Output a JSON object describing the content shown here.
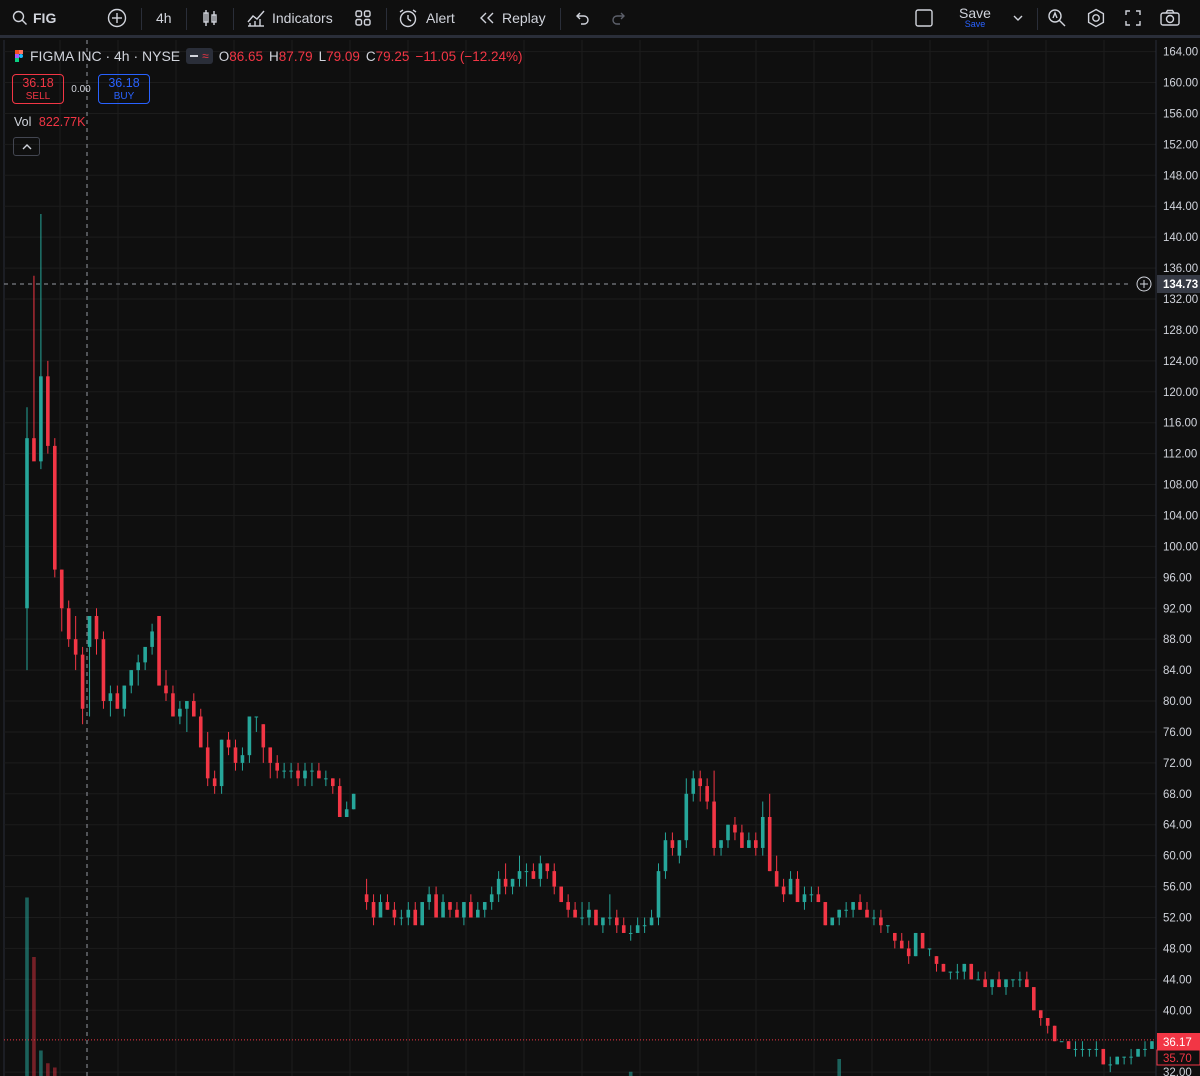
{
  "toolbar": {
    "symbol": "FIG",
    "interval": "4h",
    "indicators_label": "Indicators",
    "alert_label": "Alert",
    "replay_label": "Replay",
    "save_label": "Save",
    "save_sub_label": "Save"
  },
  "legend": {
    "title": "FIGMA INC · 4h · NYSE",
    "o_label": "O",
    "o_value": "86.65",
    "h_label": "H",
    "h_value": "87.79",
    "l_label": "L",
    "l_value": "79.09",
    "c_label": "C",
    "c_value": "79.25",
    "change": "−11.05 (−12.24%)"
  },
  "trade": {
    "sell_price": "36.18",
    "sell_label": "SELL",
    "spread": "0.00",
    "buy_price": "36.18",
    "buy_label": "BUY"
  },
  "volume": {
    "label": "Vol",
    "value": "822.77K"
  },
  "colors": {
    "up": "#26a69a",
    "down": "#f23645",
    "bg": "#0f0f0f",
    "grid": "#1c1c1c"
  },
  "chart_data": {
    "type": "candlestick",
    "ylim": [
      31.5,
      165.5
    ],
    "y_ticks": [
      "164.00",
      "160.00",
      "156.00",
      "152.00",
      "148.00",
      "144.00",
      "140.00",
      "136.00",
      "132.00",
      "128.00",
      "124.00",
      "120.00",
      "116.00",
      "112.00",
      "108.00",
      "104.00",
      "100.00",
      "96.00",
      "92.00",
      "88.00",
      "84.00",
      "80.00",
      "76.00",
      "72.00",
      "68.00",
      "64.00",
      "60.00",
      "56.00",
      "52.00",
      "48.00",
      "44.00",
      "40.00",
      "32.00"
    ],
    "crosshair_price": "134.73",
    "last_price": "36.17",
    "last_price_value": 36.17,
    "second_price": "35.70",
    "candles": [
      [
        92,
        118,
        84,
        114
      ],
      [
        114,
        135,
        112,
        111
      ],
      [
        111,
        143,
        110,
        122
      ],
      [
        122,
        124,
        112,
        113
      ],
      [
        113,
        114,
        96,
        97
      ],
      [
        97,
        97,
        89,
        92
      ],
      [
        92,
        93,
        87,
        88
      ],
      [
        88,
        91,
        84,
        86
      ],
      [
        86,
        87,
        77,
        79
      ],
      [
        87,
        88,
        78,
        91
      ],
      [
        91,
        92,
        86,
        88
      ],
      [
        88,
        89,
        79,
        80
      ],
      [
        80,
        82,
        78,
        81
      ],
      [
        81,
        82,
        79,
        79
      ],
      [
        79,
        82,
        78,
        82
      ],
      [
        82,
        84,
        81,
        84
      ],
      [
        84,
        86,
        82,
        85
      ],
      [
        85,
        86,
        84,
        87
      ],
      [
        87,
        90,
        86,
        89
      ],
      [
        91,
        91,
        82,
        82
      ],
      [
        82,
        84,
        80,
        81
      ],
      [
        81,
        82,
        78,
        78
      ],
      [
        78,
        80,
        77,
        79
      ],
      [
        79,
        80,
        76,
        80
      ],
      [
        80,
        81,
        78,
        78
      ],
      [
        78,
        79,
        75,
        74
      ],
      [
        74,
        76,
        69,
        70
      ],
      [
        70,
        71,
        68,
        69
      ],
      [
        69,
        75,
        68,
        75
      ],
      [
        75,
        76,
        73,
        74
      ],
      [
        74,
        75,
        71,
        72
      ],
      [
        72,
        74,
        71,
        73
      ],
      [
        73,
        78,
        72,
        78
      ],
      [
        78,
        78,
        76,
        78
      ],
      [
        77,
        77,
        72,
        74
      ],
      [
        74,
        74,
        70,
        72
      ],
      [
        72,
        73,
        70,
        71
      ],
      [
        71,
        72,
        70,
        71
      ],
      [
        71,
        72,
        70,
        71
      ],
      [
        71,
        72,
        69,
        70
      ],
      [
        70,
        72,
        69,
        71
      ],
      [
        71,
        72,
        69,
        71
      ],
      [
        71,
        72,
        70,
        70
      ],
      [
        70,
        71,
        69,
        70
      ],
      [
        70,
        70,
        68,
        69
      ],
      [
        69,
        70,
        65,
        65
      ],
      [
        65,
        67,
        65,
        66
      ],
      [
        66,
        68,
        66,
        68
      ],
      [
        55,
        57,
        53,
        54
      ],
      [
        54,
        55,
        51,
        52
      ],
      [
        52,
        55,
        52,
        54
      ],
      [
        54,
        55,
        53,
        53
      ],
      [
        53,
        54,
        51,
        52
      ],
      [
        52,
        53,
        51,
        52
      ],
      [
        52,
        54,
        51,
        53
      ],
      [
        53,
        54,
        52,
        51
      ],
      [
        51,
        54,
        51,
        54
      ],
      [
        54,
        56,
        53,
        55
      ],
      [
        55,
        56,
        52,
        52
      ],
      [
        52,
        55,
        52,
        54
      ],
      [
        54,
        54,
        52,
        53
      ],
      [
        53,
        54,
        52,
        52
      ],
      [
        52,
        54,
        51,
        54
      ],
      [
        54,
        55,
        52,
        52
      ],
      [
        52,
        54,
        52,
        53
      ],
      [
        53,
        54,
        52,
        54
      ],
      [
        54,
        56,
        53,
        55
      ],
      [
        55,
        58,
        54,
        57
      ],
      [
        57,
        59,
        55,
        56
      ],
      [
        56,
        57,
        55,
        57
      ],
      [
        57,
        60,
        56,
        58
      ],
      [
        58,
        59,
        56,
        58
      ],
      [
        58,
        59,
        57,
        57
      ],
      [
        57,
        60,
        56,
        59
      ],
      [
        59,
        59,
        57,
        58
      ],
      [
        58,
        59,
        55,
        56
      ],
      [
        56,
        56,
        54,
        54
      ],
      [
        54,
        55,
        52,
        53
      ],
      [
        53,
        54,
        52,
        52
      ],
      [
        52,
        54,
        51,
        52
      ],
      [
        52,
        54,
        51,
        53
      ],
      [
        53,
        53,
        51,
        51
      ],
      [
        51,
        52,
        50,
        52
      ],
      [
        52,
        55,
        51,
        52
      ],
      [
        52,
        53,
        50,
        51
      ],
      [
        51,
        52,
        50,
        50
      ],
      [
        50,
        51,
        49,
        50
      ],
      [
        50,
        52,
        50,
        51
      ],
      [
        51,
        52,
        50,
        51
      ],
      [
        51,
        53,
        51,
        52
      ],
      [
        52,
        59,
        51,
        58
      ],
      [
        58,
        63,
        57,
        62
      ],
      [
        62,
        63,
        60,
        61
      ],
      [
        60,
        62,
        59,
        62
      ],
      [
        62,
        70,
        61,
        68
      ],
      [
        68,
        71,
        67,
        70
      ],
      [
        70,
        71,
        67,
        69
      ],
      [
        69,
        70,
        66,
        67
      ],
      [
        67,
        71,
        60,
        61
      ],
      [
        61,
        62,
        60,
        62
      ],
      [
        62,
        64,
        61,
        64
      ],
      [
        64,
        65,
        62,
        63
      ],
      [
        63,
        64,
        61,
        61
      ],
      [
        61,
        63,
        61,
        62
      ],
      [
        62,
        63,
        60,
        61
      ],
      [
        61,
        67,
        60,
        65
      ],
      [
        65,
        68,
        58,
        58
      ],
      [
        58,
        60,
        56,
        56
      ],
      [
        56,
        57,
        54,
        55
      ],
      [
        55,
        58,
        55,
        57
      ],
      [
        57,
        58,
        54,
        54
      ],
      [
        54,
        56,
        53,
        55
      ],
      [
        55,
        56,
        54,
        55
      ],
      [
        55,
        56,
        54,
        54
      ],
      [
        54,
        54,
        51,
        51
      ],
      [
        51,
        52,
        51,
        52
      ],
      [
        52,
        53,
        51,
        53
      ],
      [
        53,
        54,
        52,
        53
      ],
      [
        53,
        54,
        52,
        54
      ],
      [
        54,
        55,
        53,
        53
      ],
      [
        53,
        54,
        52,
        52
      ],
      [
        52,
        53,
        51,
        52
      ],
      [
        52,
        53,
        50,
        51
      ],
      [
        51,
        51,
        50,
        51
      ],
      [
        50,
        50,
        48,
        49
      ],
      [
        49,
        50,
        48,
        48
      ],
      [
        48,
        49,
        46,
        47
      ],
      [
        47,
        50,
        47,
        50
      ],
      [
        50,
        50,
        48,
        48
      ],
      [
        48,
        48,
        47,
        48
      ],
      [
        47,
        47,
        45,
        46
      ],
      [
        46,
        46,
        45,
        45
      ],
      [
        45,
        45,
        44,
        45
      ],
      [
        45,
        46,
        44,
        45
      ],
      [
        45,
        46,
        44,
        46
      ],
      [
        46,
        46,
        44,
        44
      ],
      [
        44,
        45,
        44,
        44
      ],
      [
        44,
        45,
        43,
        43
      ],
      [
        43,
        44,
        42,
        44
      ],
      [
        44,
        45,
        43,
        43
      ],
      [
        43,
        44,
        42,
        44
      ],
      [
        44,
        44,
        43,
        44
      ],
      [
        44,
        45,
        43,
        44
      ],
      [
        44,
        45,
        43,
        43
      ],
      [
        43,
        43,
        40,
        40
      ],
      [
        40,
        40,
        38,
        39
      ],
      [
        39,
        39,
        37,
        38
      ],
      [
        38,
        38,
        36,
        36
      ],
      [
        36,
        36,
        36,
        36
      ],
      [
        36,
        36,
        35,
        35
      ],
      [
        35,
        36,
        34,
        35
      ],
      [
        35,
        36,
        34,
        35
      ],
      [
        35,
        35,
        34,
        35
      ],
      [
        35,
        36,
        34,
        35
      ],
      [
        35,
        35,
        33,
        33
      ],
      [
        33,
        34,
        32,
        33
      ],
      [
        33,
        34,
        33,
        34
      ],
      [
        34,
        34,
        33,
        34
      ],
      [
        34,
        35,
        33,
        34
      ],
      [
        34,
        35,
        34,
        35
      ],
      [
        35,
        36,
        34,
        35
      ],
      [
        35,
        36,
        35,
        36
      ],
      [
        36,
        37,
        35,
        36
      ],
      [
        36,
        37,
        35,
        36
      ],
      [
        36,
        37,
        35,
        36
      ],
      [
        36,
        36,
        35,
        36
      ],
      [
        36,
        37,
        35,
        36
      ],
      [
        36,
        37,
        35,
        36
      ]
    ],
    "volumes": [
      [
        0,
        2.1
      ],
      [
        1,
        1.4
      ],
      [
        2,
        0.3
      ],
      [
        3,
        0.15
      ],
      [
        4,
        0.1
      ],
      [
        86,
        0.05
      ],
      [
        116,
        0.2
      ]
    ]
  }
}
